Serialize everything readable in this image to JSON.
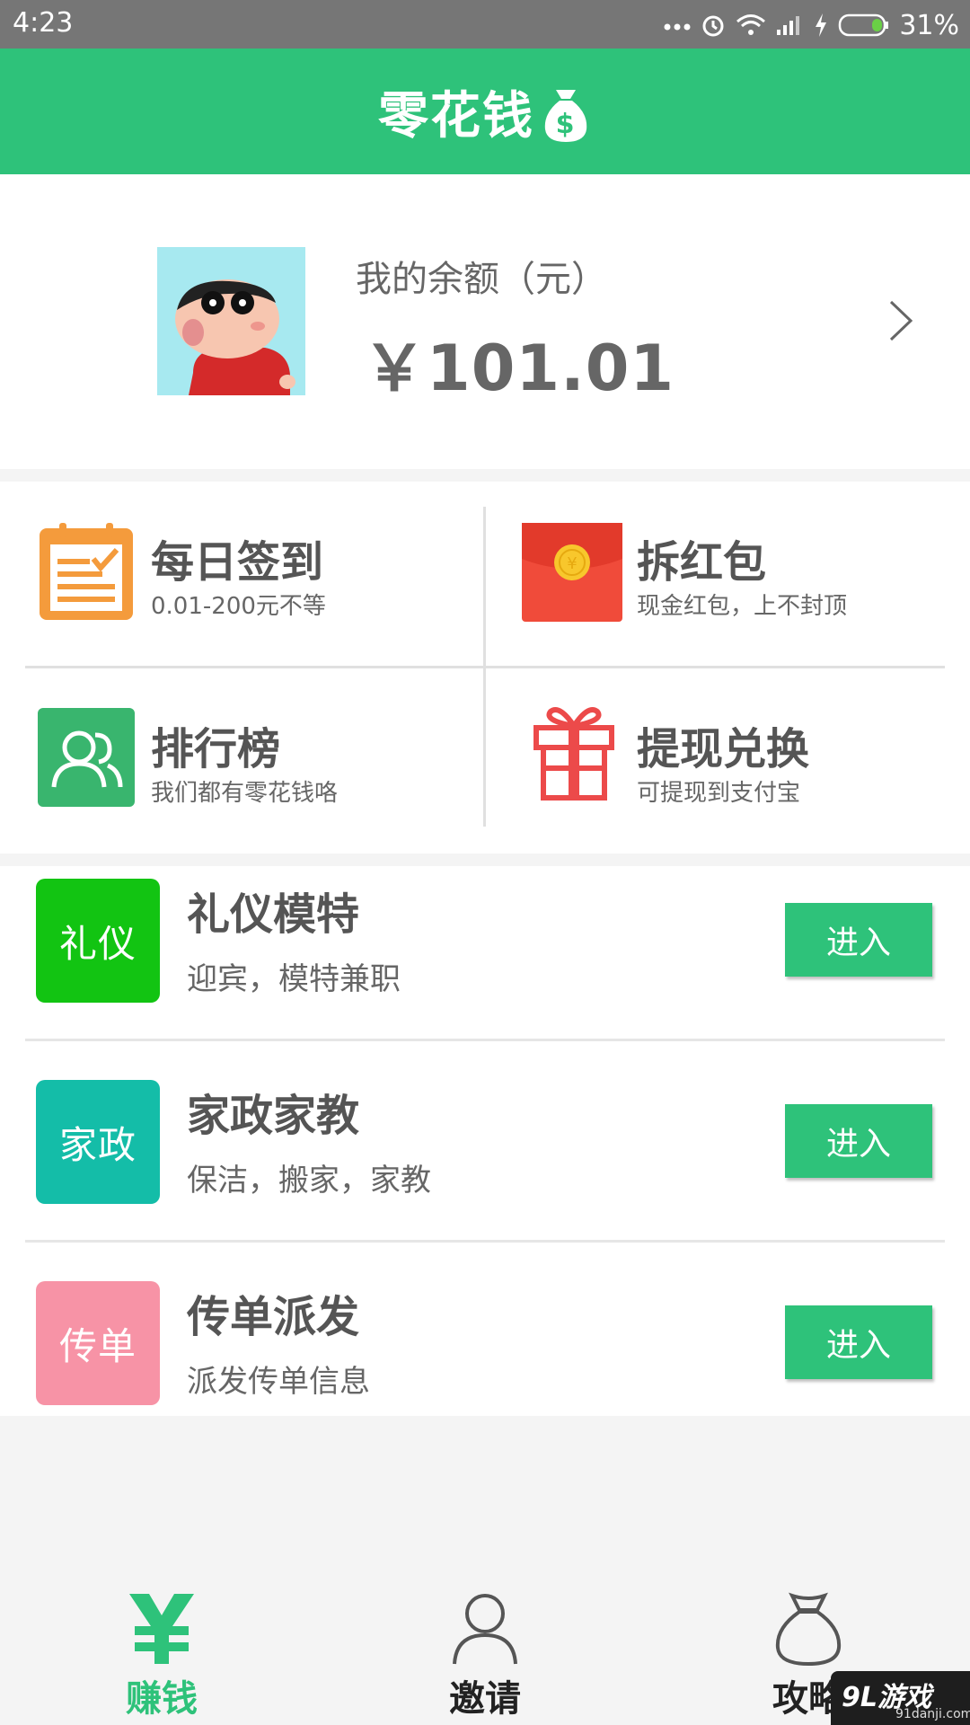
{
  "status_bar": {
    "time": "4:23",
    "battery": "31%"
  },
  "header": {
    "title": "零花钱"
  },
  "balance": {
    "label": "我的余额（元）",
    "amount": "￥101.01"
  },
  "grid": [
    {
      "title": "每日签到",
      "subtitle": "0.01-200元不等"
    },
    {
      "title": "拆红包",
      "subtitle": "现金红包，上不封顶"
    },
    {
      "title": "排行榜",
      "subtitle": "我们都有零花钱咯"
    },
    {
      "title": "提现兑换",
      "subtitle": "可提现到支付宝"
    }
  ],
  "list": [
    {
      "badge": "礼仪",
      "badge_color": "#12c412",
      "title": "礼仪模特",
      "subtitle": "迎宾，模特兼职",
      "button": "进入"
    },
    {
      "badge": "家政",
      "badge_color": "#14bda8",
      "title": "家政家教",
      "subtitle": "保洁，搬家，家教",
      "button": "进入"
    },
    {
      "badge": "传单",
      "badge_color": "#f793a6",
      "title": "传单派发",
      "subtitle": "派发传单信息",
      "button": "进入"
    }
  ],
  "nav": [
    {
      "label": "赚钱",
      "active": true
    },
    {
      "label": "邀请",
      "active": false
    },
    {
      "label": "攻略",
      "active": false
    }
  ],
  "watermark": {
    "brand": "9L游戏",
    "url": "91danji.com"
  },
  "colors": {
    "brand_green": "#2ec27a",
    "text_gray": "#555555"
  },
  "icons": {
    "header": "money-bag-icon",
    "grid": [
      "calendar-icon",
      "red-packet-icon",
      "people-icon",
      "gift-icon"
    ],
    "nav": [
      "yuan-icon",
      "person-icon",
      "bag-icon"
    ]
  }
}
